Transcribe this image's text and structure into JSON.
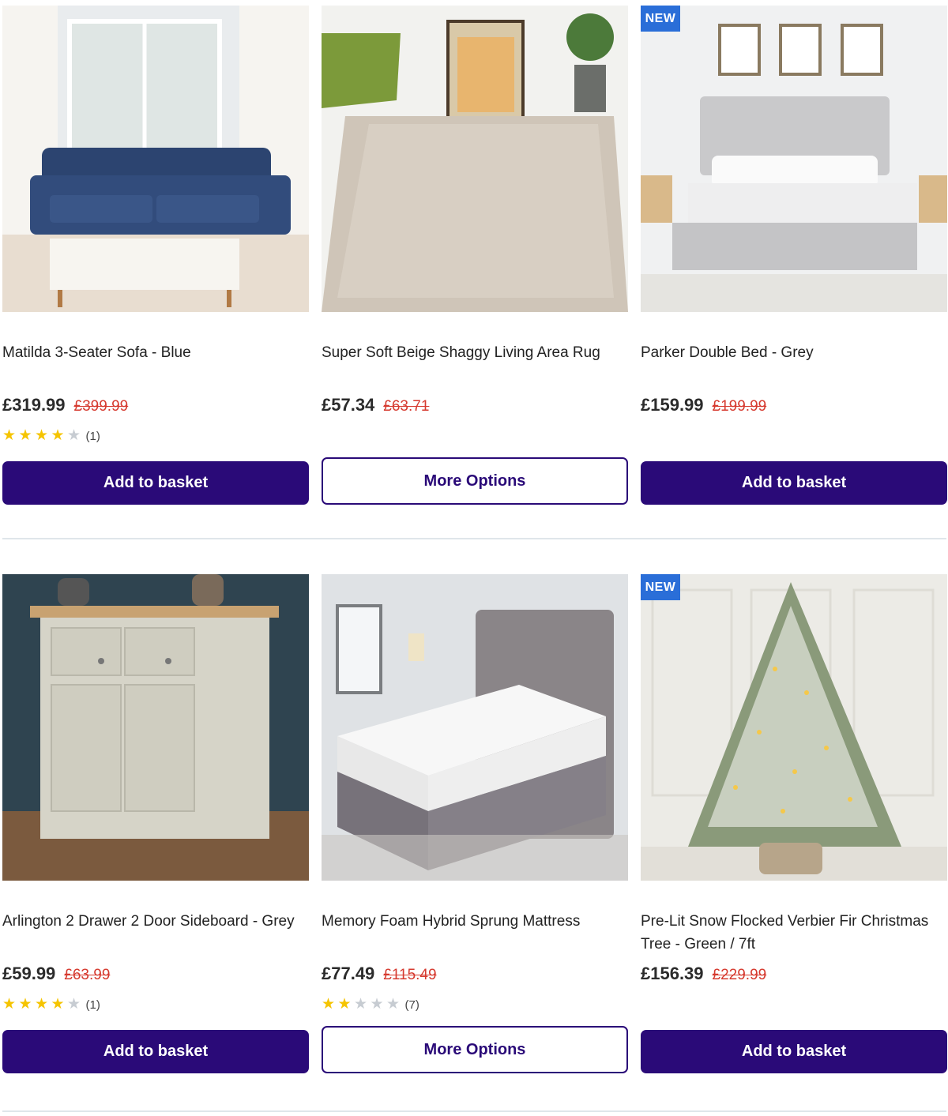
{
  "products": [
    {
      "title": "Matilda 3-Seater Sofa - Blue",
      "price": "£319.99",
      "was": "£399.99",
      "rating": 4,
      "review_count": "(1)",
      "button": "Add to basket",
      "badge": ""
    },
    {
      "title": "Super Soft Beige Shaggy Living Area Rug",
      "price": "£57.34",
      "was": "£63.71",
      "rating": null,
      "review_count": "",
      "button": "More Options",
      "badge": ""
    },
    {
      "title": "Parker Double Bed - Grey",
      "price": "£159.99",
      "was": "£199.99",
      "rating": null,
      "review_count": "",
      "button": "Add to basket",
      "badge": "NEW"
    },
    {
      "title": "Arlington 2 Drawer 2 Door Sideboard - Grey",
      "price": "£59.99",
      "was": "£63.99",
      "rating": 4,
      "review_count": "(1)",
      "button": "Add to basket",
      "badge": ""
    },
    {
      "title": "Memory Foam Hybrid Sprung Mattress",
      "price": "£77.49",
      "was": "£115.49",
      "rating": 2,
      "review_count": "(7)",
      "button": "More Options",
      "badge": ""
    },
    {
      "title": "Pre-Lit Snow Flocked Verbier Fir Christmas Tree - Green / 7ft",
      "price": "£156.39",
      "was": "£229.99",
      "rating": null,
      "review_count": "",
      "button": "Add to basket",
      "badge": "NEW"
    }
  ],
  "colors": {
    "primary_button": "#2a0a78",
    "sale_price": "#d63a2f",
    "badge": "#2a6ed8",
    "star": "#f5c400"
  }
}
